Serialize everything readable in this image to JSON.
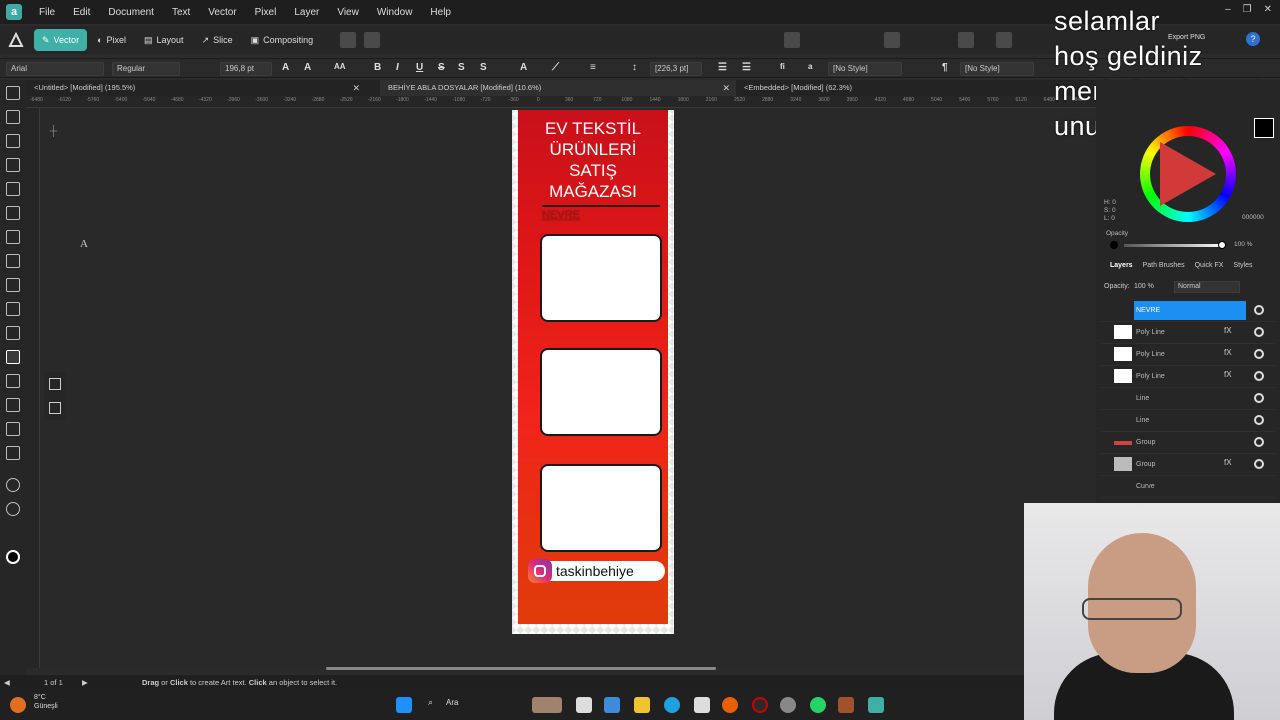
{
  "menu": {
    "items": [
      "File",
      "Edit",
      "Document",
      "Text",
      "Vector",
      "Pixel",
      "Layer",
      "View",
      "Window",
      "Help"
    ]
  },
  "toolbar": {
    "personas": [
      "Vector",
      "Pixel",
      "Layout",
      "Slice",
      "Compositing"
    ],
    "export_label": "Export PNG"
  },
  "context_bar": {
    "font_family": "Arial",
    "font_style": "Regular",
    "font_size": "196,8 pt",
    "leading": "[226,3 pt]",
    "para_style": "[No Style]",
    "char_style": "[No Style]",
    "case_label": "AA",
    "format_buttons": [
      "B",
      "I",
      "U",
      "S",
      "S",
      "S"
    ]
  },
  "tabs": [
    {
      "label": "<Untitled> [Modified] (195.5%)"
    },
    {
      "label": "BEHİYE ABLA DOSYALAR [Modified] (10.6%)"
    },
    {
      "label": "<Embedded> [Modified] (62.3%)"
    }
  ],
  "ruler": {
    "labels": [
      "-6480",
      "-6120",
      "-5760",
      "-5400",
      "-5040",
      "-4680",
      "-4320",
      "-3960",
      "-3600",
      "-3240",
      "-2880",
      "-2520",
      "-2160",
      "-1800",
      "-1440",
      "-1080",
      "-720",
      "-360",
      "0",
      "360",
      "720",
      "1080",
      "1440",
      "1800",
      "2160",
      "2520",
      "2880",
      "3240",
      "3600",
      "3960",
      "4320",
      "4680",
      "5040",
      "5400",
      "5760",
      "6120",
      "6480",
      "6840"
    ]
  },
  "poster": {
    "title_lines": [
      "EV TEKSTİL",
      "ÜRÜNLERİ",
      "SATIŞ",
      "MAĞAZASI"
    ],
    "nevre_text": "NEVRE",
    "instagram_handle": "taskinbehiye"
  },
  "overlay_text": [
    "selamlar",
    "hoş geldiniz",
    "merhaba demeyi",
    "unutma."
  ],
  "color_panel": {
    "hex": "000000",
    "opacity_label": "Opacity",
    "opacity_value": "100 %",
    "hsl": [
      "H: 0",
      "S: 0",
      "L: 0"
    ]
  },
  "layers_panel": {
    "tabs": [
      "Layers",
      "Path Brushes",
      "Quick FX",
      "Styles"
    ],
    "opacity_label": "Opacity:",
    "opacity_value": "100 %",
    "blend_mode": "Normal",
    "rows": [
      {
        "name": "NEVRE",
        "selected": true,
        "thumb": false,
        "fx": ""
      },
      {
        "name": "Poly Line",
        "selected": false,
        "thumb": true,
        "fx": "fX"
      },
      {
        "name": "Poly Line",
        "selected": false,
        "thumb": true,
        "fx": "fX"
      },
      {
        "name": "Poly Line",
        "selected": false,
        "thumb": true,
        "fx": "fX"
      },
      {
        "name": "Line",
        "selected": false,
        "thumb": false,
        "fx": ""
      },
      {
        "name": "Line",
        "selected": false,
        "thumb": false,
        "fx": ""
      },
      {
        "name": "Group",
        "selected": false,
        "thumb": false,
        "fx": ""
      },
      {
        "name": "Group",
        "selected": false,
        "thumb": false,
        "fx": "fX"
      },
      {
        "name": "Curve",
        "selected": false,
        "thumb": false,
        "fx": ""
      }
    ]
  },
  "status": {
    "page": "1 of 1",
    "hint_drag": "Drag",
    "hint_or": " or ",
    "hint_click": "Click",
    "hint_rest1": " to create Art text. ",
    "hint_click2": "Click",
    "hint_rest2": " an object to select it."
  },
  "taskbar": {
    "weather_temp": "8°C",
    "weather_desc": "Güneşli",
    "search_label": "Ara"
  },
  "colors": {
    "accent": "#3fb0a6",
    "poster_red": "#e01717",
    "layer_selected": "#1c8ff2"
  }
}
